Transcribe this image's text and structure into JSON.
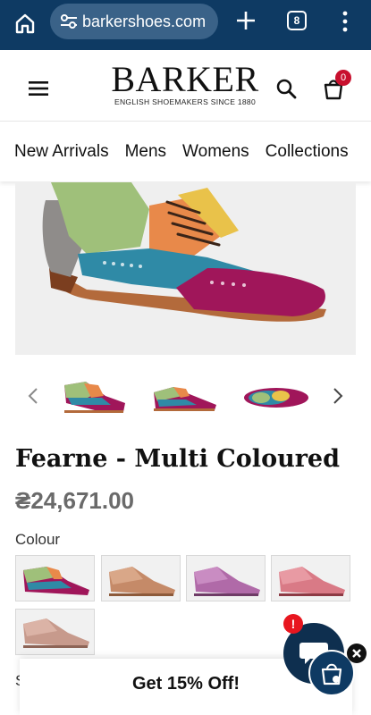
{
  "browser": {
    "url": "barkershoes.com",
    "tab_count": "8",
    "icons": [
      "home-icon",
      "site-settings-icon",
      "plus-icon",
      "tabs-icon",
      "more-vert-icon"
    ],
    "bar_color": "#0e3a63"
  },
  "header": {
    "logo_word": "BARKER",
    "logo_tagline": "ENGLISH SHOEMAKERS SINCE 1880",
    "cart_count": "0",
    "icons": [
      "menu-icon",
      "search-icon",
      "bag-icon"
    ]
  },
  "nav": {
    "items": [
      "New Arrivals",
      "Mens",
      "Womens",
      "Collections"
    ]
  },
  "product": {
    "title": "Fearne - Multi Coloured",
    "price": "₴24,671.00",
    "colour_label": "Colour",
    "next_section_peek": "S",
    "swatches": [
      "Multi Coloured",
      "Tan",
      "Lilac",
      "Pink",
      "Rose Gold"
    ]
  },
  "promo": {
    "text": "Get 15% Off!"
  },
  "chat": {
    "alert": "!",
    "icons": [
      "chat-icon",
      "close-icon",
      "shopping-bag-icon"
    ]
  },
  "colors": {
    "accent": "#0e3a63",
    "badge": "#c8102e",
    "alert": "#e8161f"
  }
}
